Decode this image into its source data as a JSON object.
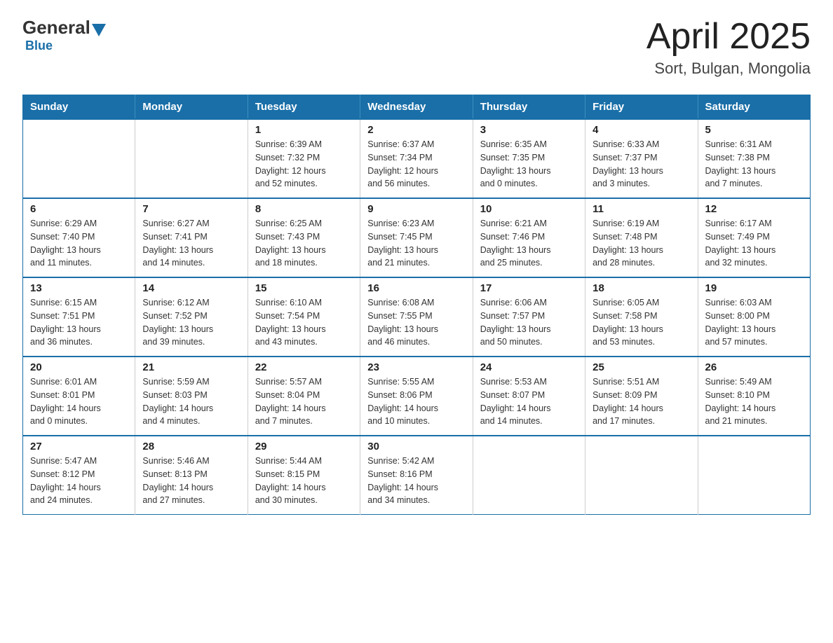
{
  "logo": {
    "general": "General",
    "blue": "Blue"
  },
  "title": "April 2025",
  "subtitle": "Sort, Bulgan, Mongolia",
  "days_of_week": [
    "Sunday",
    "Monday",
    "Tuesday",
    "Wednesday",
    "Thursday",
    "Friday",
    "Saturday"
  ],
  "weeks": [
    [
      {
        "day": "",
        "info": ""
      },
      {
        "day": "",
        "info": ""
      },
      {
        "day": "1",
        "info": "Sunrise: 6:39 AM\nSunset: 7:32 PM\nDaylight: 12 hours\nand 52 minutes."
      },
      {
        "day": "2",
        "info": "Sunrise: 6:37 AM\nSunset: 7:34 PM\nDaylight: 12 hours\nand 56 minutes."
      },
      {
        "day": "3",
        "info": "Sunrise: 6:35 AM\nSunset: 7:35 PM\nDaylight: 13 hours\nand 0 minutes."
      },
      {
        "day": "4",
        "info": "Sunrise: 6:33 AM\nSunset: 7:37 PM\nDaylight: 13 hours\nand 3 minutes."
      },
      {
        "day": "5",
        "info": "Sunrise: 6:31 AM\nSunset: 7:38 PM\nDaylight: 13 hours\nand 7 minutes."
      }
    ],
    [
      {
        "day": "6",
        "info": "Sunrise: 6:29 AM\nSunset: 7:40 PM\nDaylight: 13 hours\nand 11 minutes."
      },
      {
        "day": "7",
        "info": "Sunrise: 6:27 AM\nSunset: 7:41 PM\nDaylight: 13 hours\nand 14 minutes."
      },
      {
        "day": "8",
        "info": "Sunrise: 6:25 AM\nSunset: 7:43 PM\nDaylight: 13 hours\nand 18 minutes."
      },
      {
        "day": "9",
        "info": "Sunrise: 6:23 AM\nSunset: 7:45 PM\nDaylight: 13 hours\nand 21 minutes."
      },
      {
        "day": "10",
        "info": "Sunrise: 6:21 AM\nSunset: 7:46 PM\nDaylight: 13 hours\nand 25 minutes."
      },
      {
        "day": "11",
        "info": "Sunrise: 6:19 AM\nSunset: 7:48 PM\nDaylight: 13 hours\nand 28 minutes."
      },
      {
        "day": "12",
        "info": "Sunrise: 6:17 AM\nSunset: 7:49 PM\nDaylight: 13 hours\nand 32 minutes."
      }
    ],
    [
      {
        "day": "13",
        "info": "Sunrise: 6:15 AM\nSunset: 7:51 PM\nDaylight: 13 hours\nand 36 minutes."
      },
      {
        "day": "14",
        "info": "Sunrise: 6:12 AM\nSunset: 7:52 PM\nDaylight: 13 hours\nand 39 minutes."
      },
      {
        "day": "15",
        "info": "Sunrise: 6:10 AM\nSunset: 7:54 PM\nDaylight: 13 hours\nand 43 minutes."
      },
      {
        "day": "16",
        "info": "Sunrise: 6:08 AM\nSunset: 7:55 PM\nDaylight: 13 hours\nand 46 minutes."
      },
      {
        "day": "17",
        "info": "Sunrise: 6:06 AM\nSunset: 7:57 PM\nDaylight: 13 hours\nand 50 minutes."
      },
      {
        "day": "18",
        "info": "Sunrise: 6:05 AM\nSunset: 7:58 PM\nDaylight: 13 hours\nand 53 minutes."
      },
      {
        "day": "19",
        "info": "Sunrise: 6:03 AM\nSunset: 8:00 PM\nDaylight: 13 hours\nand 57 minutes."
      }
    ],
    [
      {
        "day": "20",
        "info": "Sunrise: 6:01 AM\nSunset: 8:01 PM\nDaylight: 14 hours\nand 0 minutes."
      },
      {
        "day": "21",
        "info": "Sunrise: 5:59 AM\nSunset: 8:03 PM\nDaylight: 14 hours\nand 4 minutes."
      },
      {
        "day": "22",
        "info": "Sunrise: 5:57 AM\nSunset: 8:04 PM\nDaylight: 14 hours\nand 7 minutes."
      },
      {
        "day": "23",
        "info": "Sunrise: 5:55 AM\nSunset: 8:06 PM\nDaylight: 14 hours\nand 10 minutes."
      },
      {
        "day": "24",
        "info": "Sunrise: 5:53 AM\nSunset: 8:07 PM\nDaylight: 14 hours\nand 14 minutes."
      },
      {
        "day": "25",
        "info": "Sunrise: 5:51 AM\nSunset: 8:09 PM\nDaylight: 14 hours\nand 17 minutes."
      },
      {
        "day": "26",
        "info": "Sunrise: 5:49 AM\nSunset: 8:10 PM\nDaylight: 14 hours\nand 21 minutes."
      }
    ],
    [
      {
        "day": "27",
        "info": "Sunrise: 5:47 AM\nSunset: 8:12 PM\nDaylight: 14 hours\nand 24 minutes."
      },
      {
        "day": "28",
        "info": "Sunrise: 5:46 AM\nSunset: 8:13 PM\nDaylight: 14 hours\nand 27 minutes."
      },
      {
        "day": "29",
        "info": "Sunrise: 5:44 AM\nSunset: 8:15 PM\nDaylight: 14 hours\nand 30 minutes."
      },
      {
        "day": "30",
        "info": "Sunrise: 5:42 AM\nSunset: 8:16 PM\nDaylight: 14 hours\nand 34 minutes."
      },
      {
        "day": "",
        "info": ""
      },
      {
        "day": "",
        "info": ""
      },
      {
        "day": "",
        "info": ""
      }
    ]
  ]
}
